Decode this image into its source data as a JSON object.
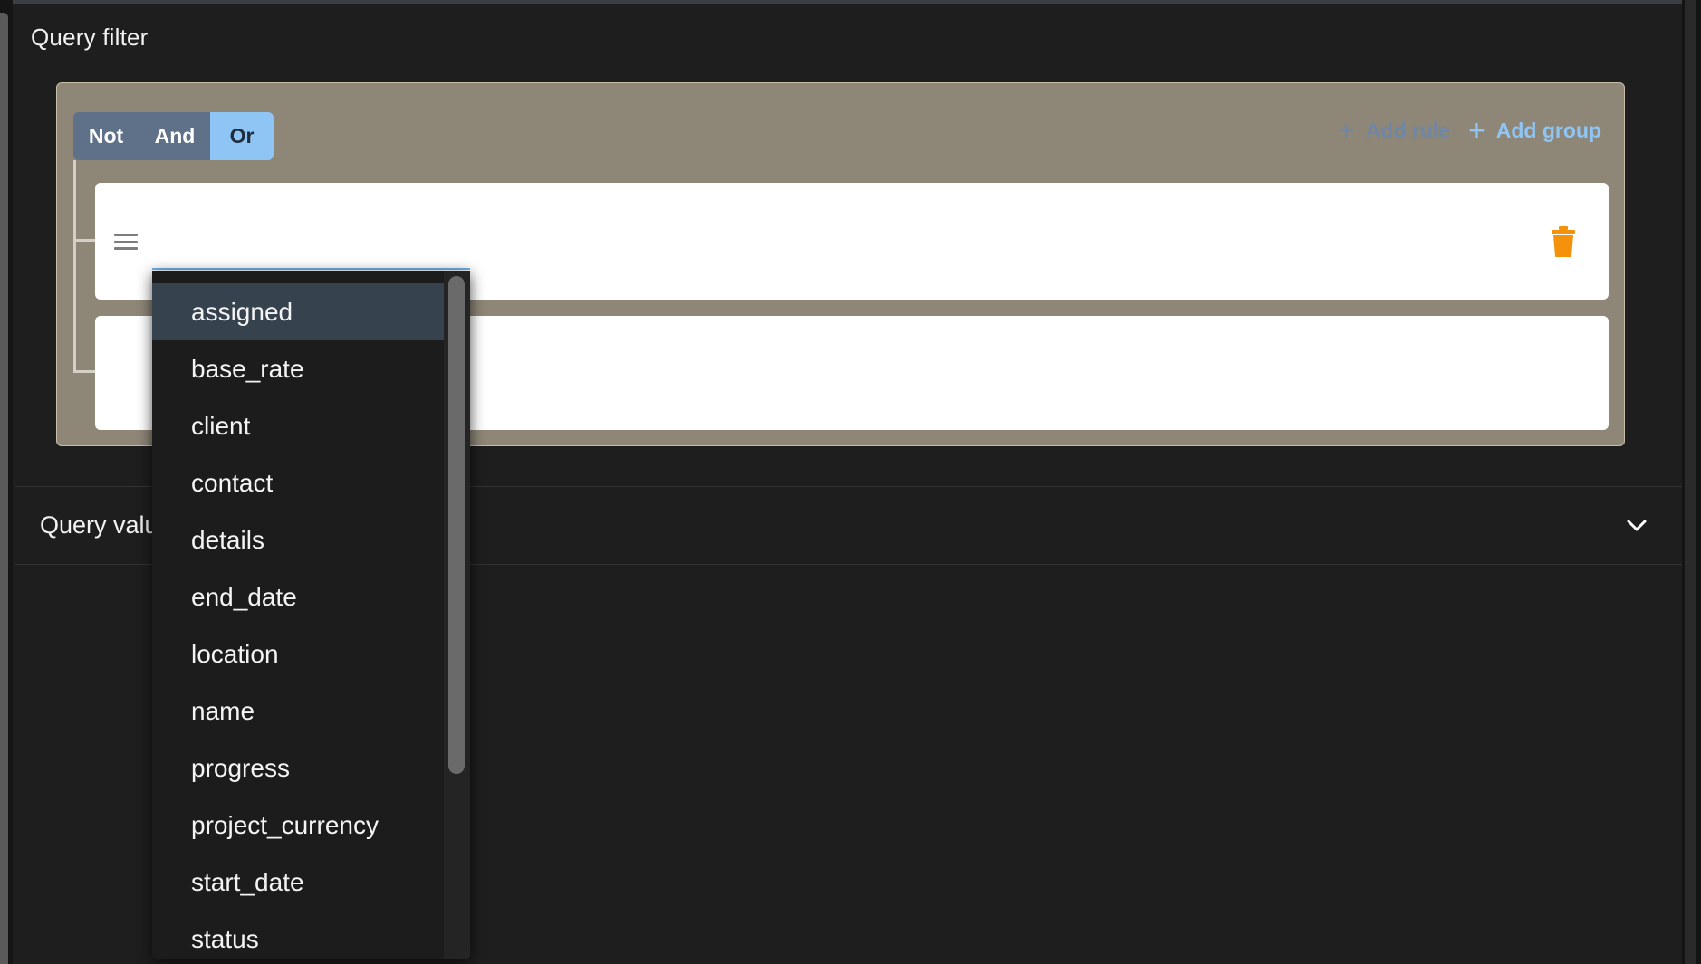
{
  "query_filter": {
    "title": "Query filter",
    "combinator": {
      "buttons": [
        "Not",
        "And",
        "Or"
      ],
      "selected": "Or"
    },
    "actions": {
      "add_rule_label": "Add rule",
      "add_group_label": "Add group",
      "plus_icon": "plus-icon"
    }
  },
  "rule_1": {
    "drag_icon": "drag-handle-icon",
    "delete_icon": "trash-icon"
  },
  "field_dropdown": {
    "selected": "assigned",
    "items": [
      "assigned",
      "base_rate",
      "client",
      "contact",
      "details",
      "end_date",
      "location",
      "name",
      "progress",
      "project_currency",
      "start_date",
      "status"
    ]
  },
  "query_values": {
    "title": "Query values",
    "visible_label": "Query valu",
    "toggle_icon": "chevron-down-icon"
  },
  "colors": {
    "group_bg": "#8e8677",
    "selected_combinator": "#8ec5f4",
    "inactive_combinator": "#5e7189",
    "delete_icon": "#f5920b",
    "highlight": "#36424e"
  }
}
